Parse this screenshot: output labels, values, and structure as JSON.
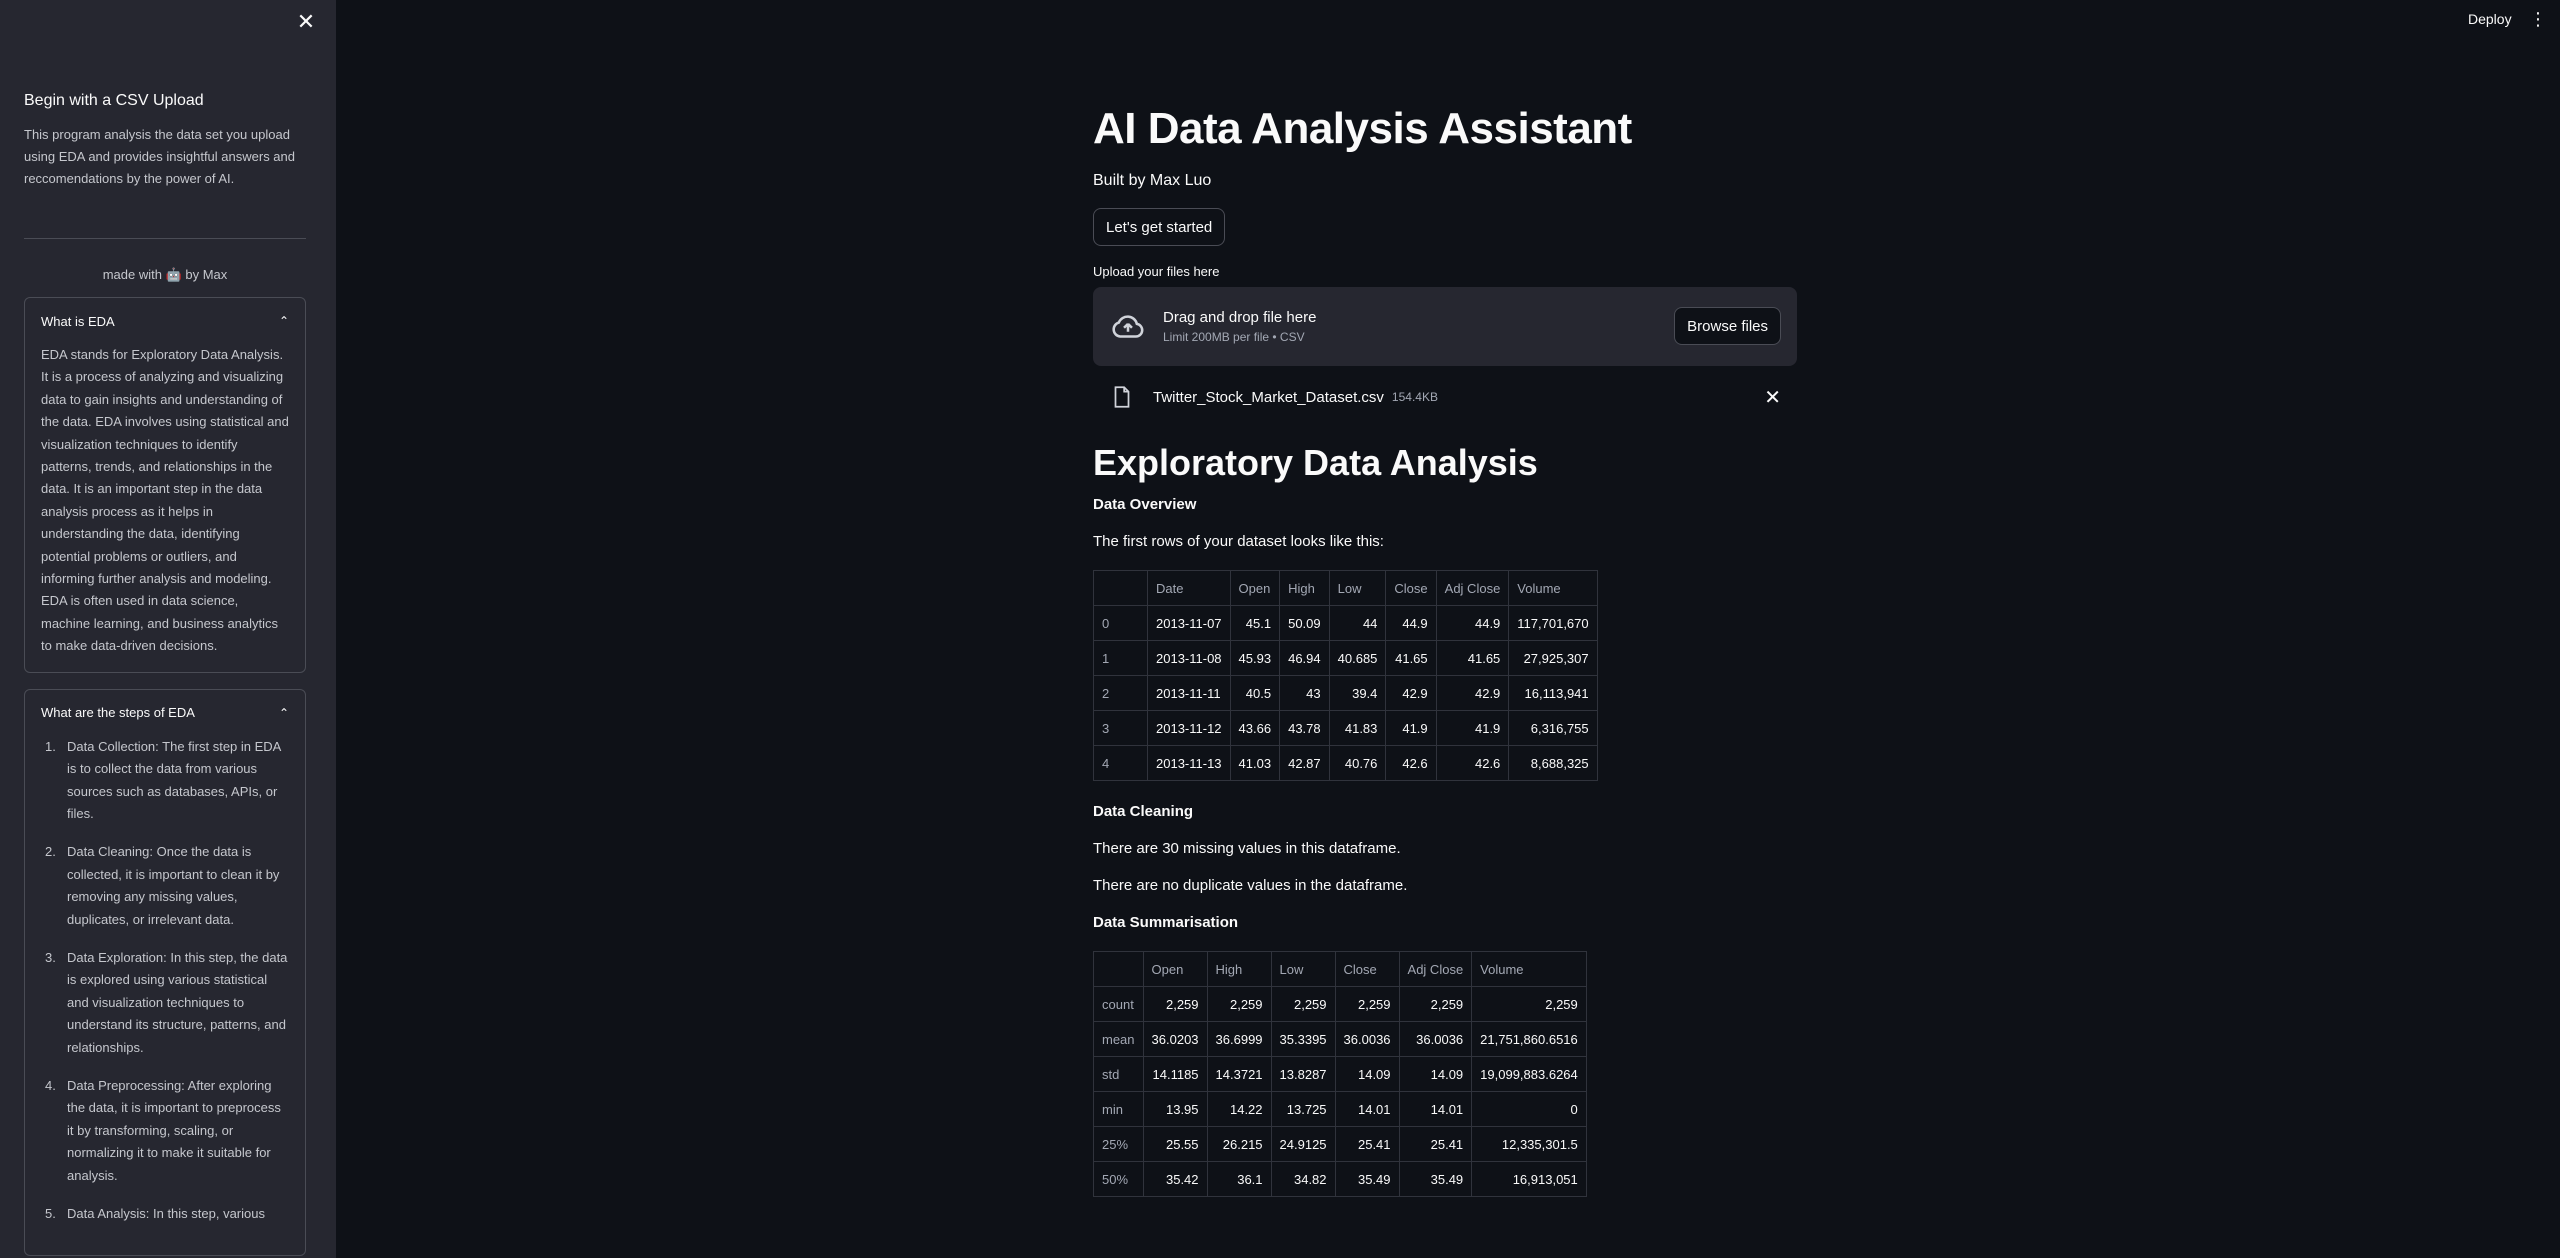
{
  "header": {
    "deploy_label": "Deploy"
  },
  "sidebar": {
    "title": "Begin with a CSV Upload",
    "description": "This program analysis the data set you upload using EDA and provides insightful answers and reccomendations by the power of AI.",
    "made_with": "made with 🤖 by Max",
    "expander_eda": {
      "title": "What is EDA",
      "body": "EDA stands for Exploratory Data Analysis. It is a process of analyzing and visualizing data to gain insights and understanding of the data. EDA involves using statistical and visualization techniques to identify patterns, trends, and relationships in the data. It is an important step in the data analysis process as it helps in understanding the data, identifying potential problems or outliers, and informing further analysis and modeling. EDA is often used in data science, machine learning, and business analytics to make data-driven decisions."
    },
    "expander_steps": {
      "title": "What are the steps of EDA",
      "steps": [
        {
          "num": "1.",
          "text": "Data Collection: The first step in EDA is to collect the data from various sources such as databases, APIs, or files."
        },
        {
          "num": "2.",
          "text": "Data Cleaning: Once the data is collected, it is important to clean it by removing any missing values, duplicates, or irrelevant data."
        },
        {
          "num": "3.",
          "text": "Data Exploration: In this step, the data is explored using various statistical and visualization techniques to understand its structure, patterns, and relationships."
        },
        {
          "num": "4.",
          "text": "Data Preprocessing: After exploring the data, it is important to preprocess it by transforming, scaling, or normalizing it to make it suitable for analysis."
        },
        {
          "num": "5.",
          "text": "Data Analysis: In this step, various"
        }
      ]
    }
  },
  "main": {
    "title": "AI Data Analysis Assistant",
    "built_by": "Built by Max Luo",
    "start_button": "Let's get started",
    "upload_label": "Upload your files here",
    "dropzone_title": "Drag and drop file here",
    "dropzone_sub": "Limit 200MB per file • CSV",
    "browse_label": "Browse files",
    "file_name": "Twitter_Stock_Market_Dataset.csv",
    "file_size": "154.4KB",
    "eda_heading": "Exploratory Data Analysis",
    "overview_heading": "Data Overview",
    "overview_text": "The first rows of your dataset looks like this:",
    "head_table": {
      "columns": [
        "",
        "Date",
        "Open",
        "High",
        "Low",
        "Close",
        "Adj Close",
        "Volume"
      ],
      "rows": [
        [
          "0",
          "2013-11-07",
          "45.1",
          "50.09",
          "44",
          "44.9",
          "44.9",
          "117,701,670"
        ],
        [
          "1",
          "2013-11-08",
          "45.93",
          "46.94",
          "40.685",
          "41.65",
          "41.65",
          "27,925,307"
        ],
        [
          "2",
          "2013-11-11",
          "40.5",
          "43",
          "39.4",
          "42.9",
          "42.9",
          "16,113,941"
        ],
        [
          "3",
          "2013-11-12",
          "43.66",
          "43.78",
          "41.83",
          "41.9",
          "41.9",
          "6,316,755"
        ],
        [
          "4",
          "2013-11-13",
          "41.03",
          "42.87",
          "40.76",
          "42.6",
          "42.6",
          "8,688,325"
        ]
      ]
    },
    "cleaning_heading": "Data Cleaning",
    "missing_text": "There are 30 missing values in this dataframe.",
    "duplicate_text": "There are no duplicate values in the dataframe.",
    "summary_heading": "Data Summarisation",
    "summary_table": {
      "columns": [
        "",
        "Open",
        "High",
        "Low",
        "Close",
        "Adj Close",
        "Volume"
      ],
      "rows": [
        [
          "count",
          "2,259",
          "2,259",
          "2,259",
          "2,259",
          "2,259",
          "2,259"
        ],
        [
          "mean",
          "36.0203",
          "36.6999",
          "35.3395",
          "36.0036",
          "36.0036",
          "21,751,860.6516"
        ],
        [
          "std",
          "14.1185",
          "14.3721",
          "13.8287",
          "14.09",
          "14.09",
          "19,099,883.6264"
        ],
        [
          "min",
          "13.95",
          "14.22",
          "13.725",
          "14.01",
          "14.01",
          "0"
        ],
        [
          "25%",
          "25.55",
          "26.215",
          "24.9125",
          "25.41",
          "25.41",
          "12,335,301.5"
        ],
        [
          "50%",
          "35.42",
          "36.1",
          "34.82",
          "35.49",
          "35.49",
          "16,913,051"
        ]
      ]
    }
  }
}
